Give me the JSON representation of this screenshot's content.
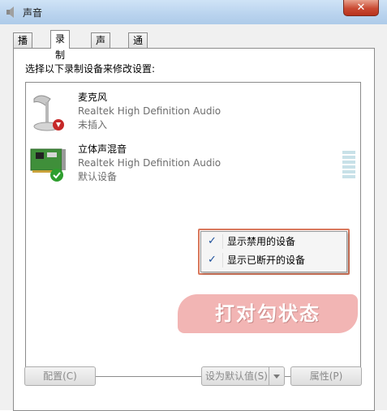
{
  "window": {
    "title": "声音",
    "close_label": "✕"
  },
  "tabs": [
    {
      "label": "播放",
      "active": false
    },
    {
      "label": "录制",
      "active": true
    },
    {
      "label": "声音",
      "active": false
    },
    {
      "label": "通信",
      "active": false
    }
  ],
  "instruction": "选择以下录制设备来修改设置:",
  "devices": [
    {
      "name": "麦克风",
      "description": "Realtek High Definition Audio",
      "status": "未插入",
      "icon": "microphone-icon",
      "badge": "unplugged-badge-icon"
    },
    {
      "name": "立体声混音",
      "description": "Realtek High Definition Audio",
      "status": "默认设备",
      "icon": "sound-card-icon",
      "badge": "default-check-badge-icon"
    }
  ],
  "context_menu": {
    "items": [
      {
        "label": "显示禁用的设备",
        "checked": true
      },
      {
        "label": "显示已断开的设备",
        "checked": true
      }
    ]
  },
  "annotation": {
    "text": "打对勾状态"
  },
  "buttons": {
    "configure": "配置(C)",
    "set_default": "设为默认值(S)",
    "properties": "属性(P)"
  },
  "colors": {
    "annotation_fill": "#f2b5b4",
    "menu_outline": "#d9785c",
    "check_color": "#1c4e9a",
    "level_meter": "#c8e1e8"
  }
}
